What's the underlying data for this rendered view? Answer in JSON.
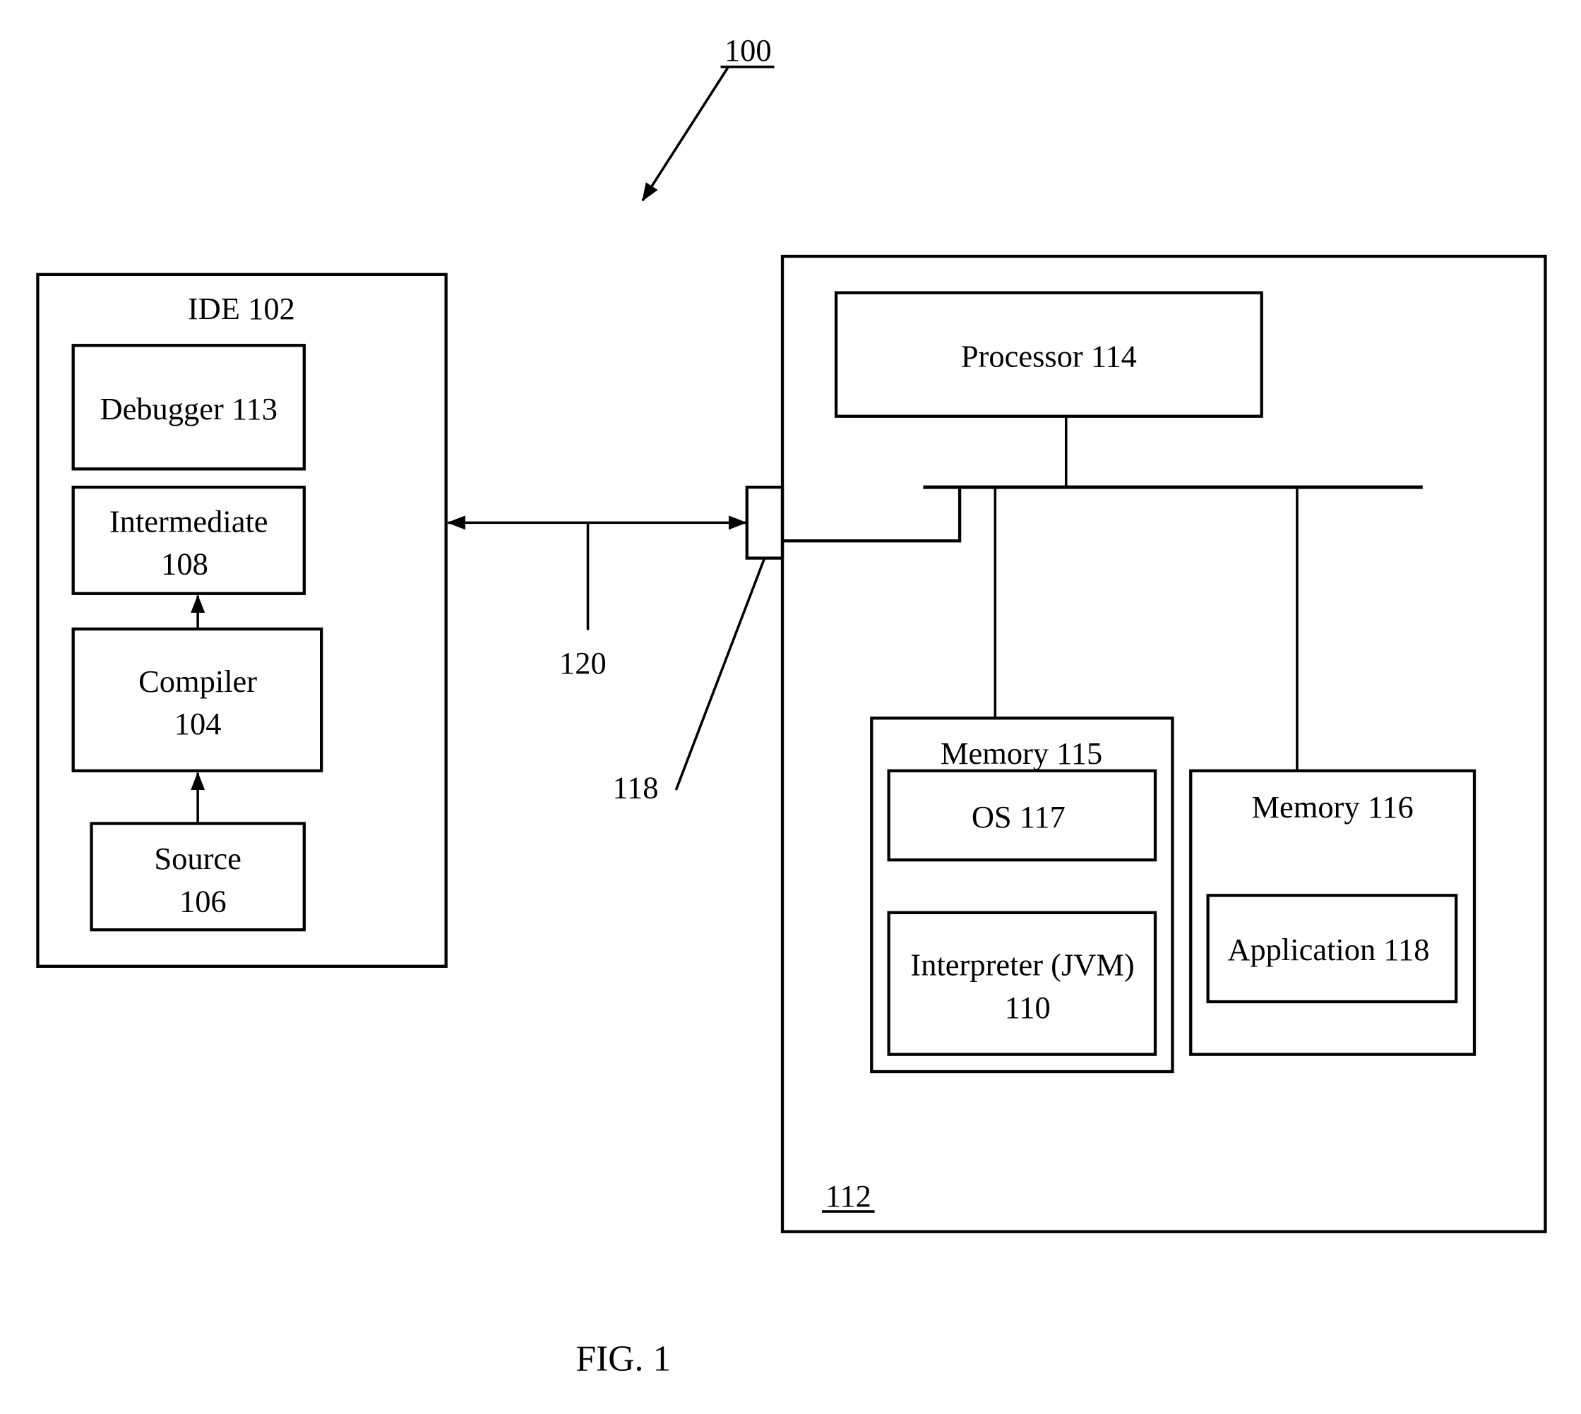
{
  "figure": {
    "caption": "FIG. 1",
    "system_ref": "100",
    "device_ref": "112",
    "link_ref": "120",
    "port_ref": "118"
  },
  "ide": {
    "title": "IDE 102",
    "debugger": "Debugger 113",
    "intermediate_line1": "Intermediate",
    "intermediate_line2": "108",
    "compiler_line1": "Compiler",
    "compiler_line2": "104",
    "source_line1": "Source",
    "source_line2": "106"
  },
  "device": {
    "processor": "Processor 114",
    "memory115": "Memory 115",
    "os": "OS 117",
    "interpreter_line1": "Interpreter (JVM)",
    "interpreter_line2": "110",
    "memory116": "Memory 116",
    "application": "Application 118"
  }
}
